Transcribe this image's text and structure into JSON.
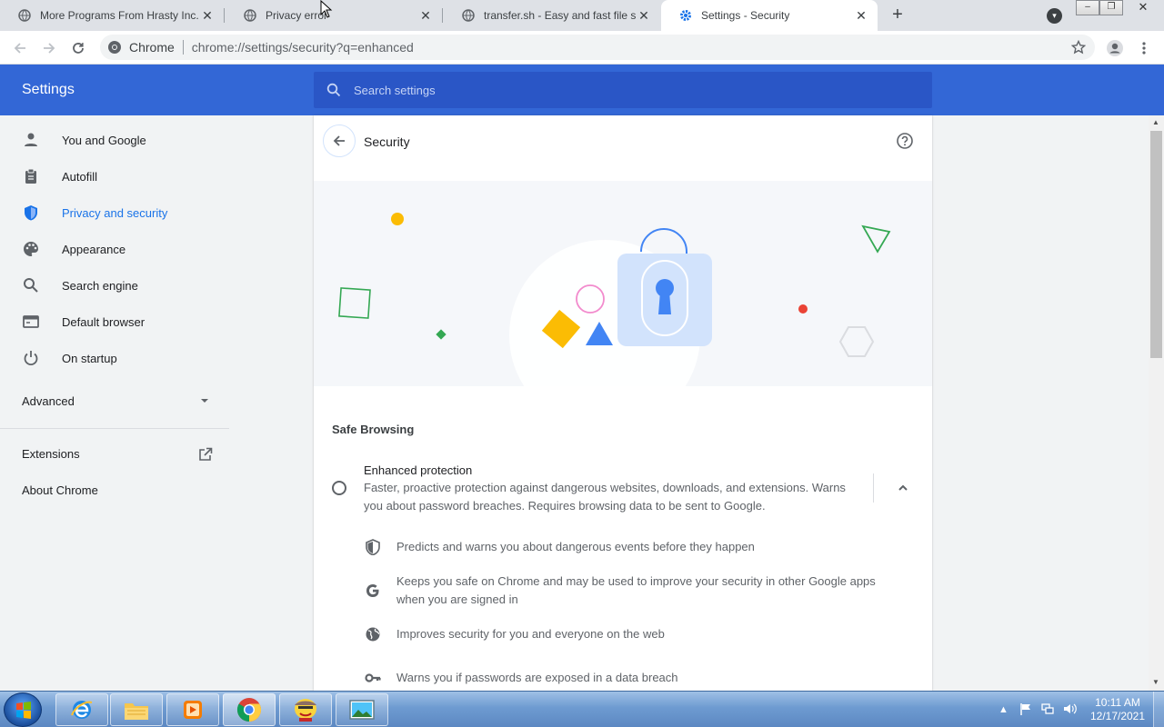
{
  "tabs": [
    {
      "title": "More Programs From Hrasty Inc.",
      "icon": "globe-icon",
      "active": false
    },
    {
      "title": "Privacy error",
      "icon": "globe-icon",
      "active": false
    },
    {
      "title": "transfer.sh - Easy and fast file sha",
      "icon": "globe-icon",
      "active": false
    },
    {
      "title": "Settings - Security",
      "icon": "gear-icon",
      "active": true
    }
  ],
  "toolbar": {
    "site_label": "Chrome",
    "url": "chrome://settings/security?q=enhanced"
  },
  "header": {
    "title": "Settings",
    "search_placeholder": "Search settings"
  },
  "sidebar": {
    "items": [
      {
        "label": "You and Google",
        "icon": "person-icon"
      },
      {
        "label": "Autofill",
        "icon": "clipboard-icon"
      },
      {
        "label": "Privacy and security",
        "icon": "shield-icon",
        "selected": true
      },
      {
        "label": "Appearance",
        "icon": "palette-icon"
      },
      {
        "label": "Search engine",
        "icon": "search-icon"
      },
      {
        "label": "Default browser",
        "icon": "browser-icon"
      },
      {
        "label": "On startup",
        "icon": "power-icon"
      }
    ],
    "advanced": "Advanced",
    "extensions": "Extensions",
    "about": "About Chrome"
  },
  "page": {
    "title": "Security",
    "section": "Safe Browsing",
    "option": {
      "label": "Enhanced protection",
      "description": "Faster, proactive protection against dangerous websites, downloads, and extensions. Warns you about password breaches. Requires browsing data to be sent to Google."
    },
    "features": [
      {
        "text": "Predicts and warns you about dangerous events before they happen",
        "icon": "shield-icon"
      },
      {
        "text": "Keeps you safe on Chrome and may be used to improve your security in other Google apps when you are signed in",
        "icon": "google-g-icon"
      },
      {
        "text": "Improves security for you and everyone on the web",
        "icon": "globe-icon"
      },
      {
        "text": "Warns you if passwords are exposed in a data breach",
        "icon": "key-icon"
      }
    ]
  },
  "taskbar": {
    "time": "10:11 AM",
    "date": "12/17/2021"
  },
  "colors": {
    "header_blue": "#3367d6",
    "accent_blue": "#1a73e8"
  }
}
